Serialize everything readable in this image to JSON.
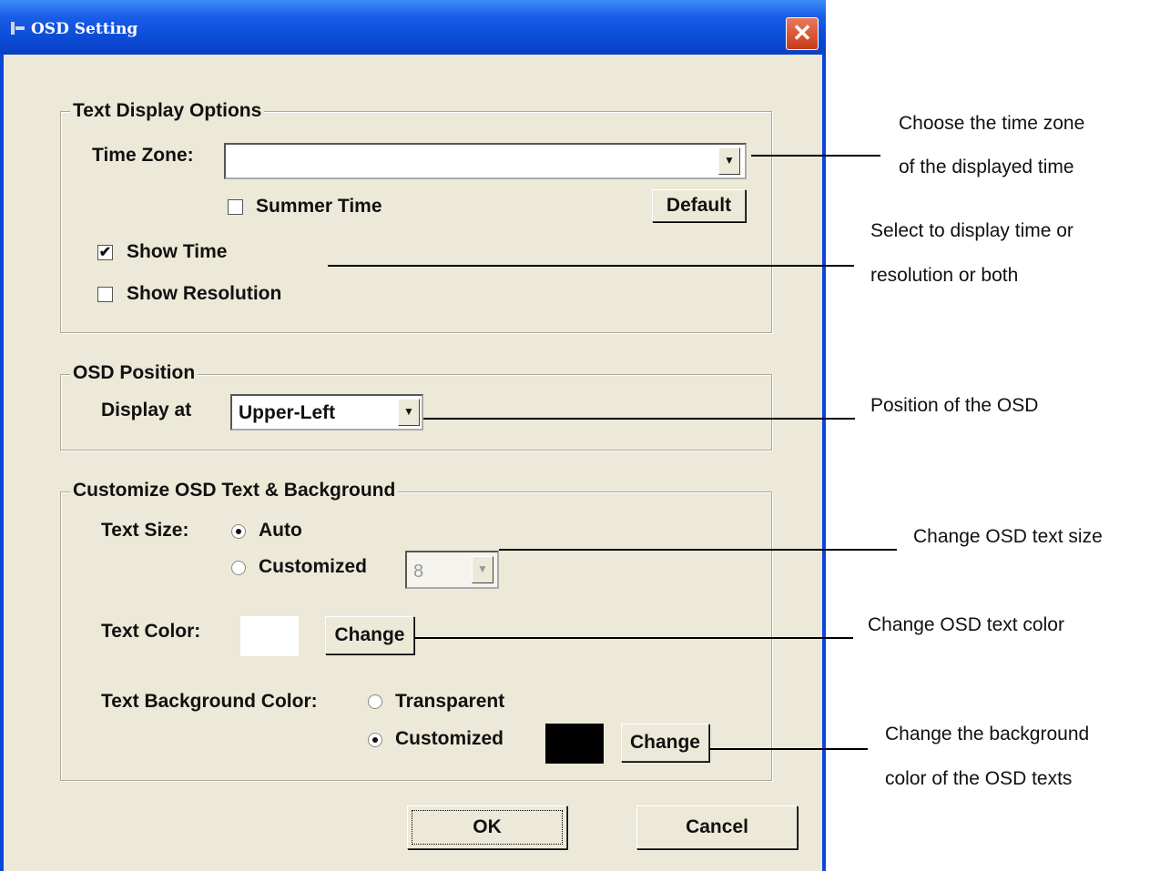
{
  "window": {
    "title": "OSD Setting",
    "close_glyph": "✕"
  },
  "text_display": {
    "group_label": "Text Display Options",
    "time_zone_label": "Time Zone:",
    "time_zone_value": "",
    "summer_time_label": "Summer Time",
    "summer_time_checked": false,
    "default_button": "Default",
    "show_time_label": "Show Time",
    "show_time_checked": true,
    "show_resolution_label": "Show Resolution",
    "show_resolution_checked": false
  },
  "osd_position": {
    "group_label": "OSD Position",
    "display_at_label": "Display at",
    "display_at_value": "Upper-Left"
  },
  "customize": {
    "group_label": "Customize OSD Text & Background",
    "text_size_label": "Text Size:",
    "auto_label": "Auto",
    "customized_label": "Customized",
    "text_size_value": "8",
    "text_color_label": "Text Color:",
    "text_color": "#ffffff",
    "change_label": "Change",
    "bg_color_label": "Text Background Color:",
    "transparent_label": "Transparent",
    "bg_customized_label": "Customized",
    "bg_color": "#000000"
  },
  "footer": {
    "ok": "OK",
    "cancel": "Cancel"
  },
  "annotations": {
    "time_zone_1": "Choose the time zone",
    "time_zone_2": "of the displayed time",
    "show_1": "Select to display time or",
    "show_2": "resolution or both",
    "position": "Position of the OSD",
    "text_size": "Change OSD text size",
    "text_color": "Change OSD text color",
    "bg_1": "Change the background",
    "bg_2": "color of the OSD texts"
  },
  "icons": {
    "checkmark": "✔",
    "dropdown": "▼"
  }
}
